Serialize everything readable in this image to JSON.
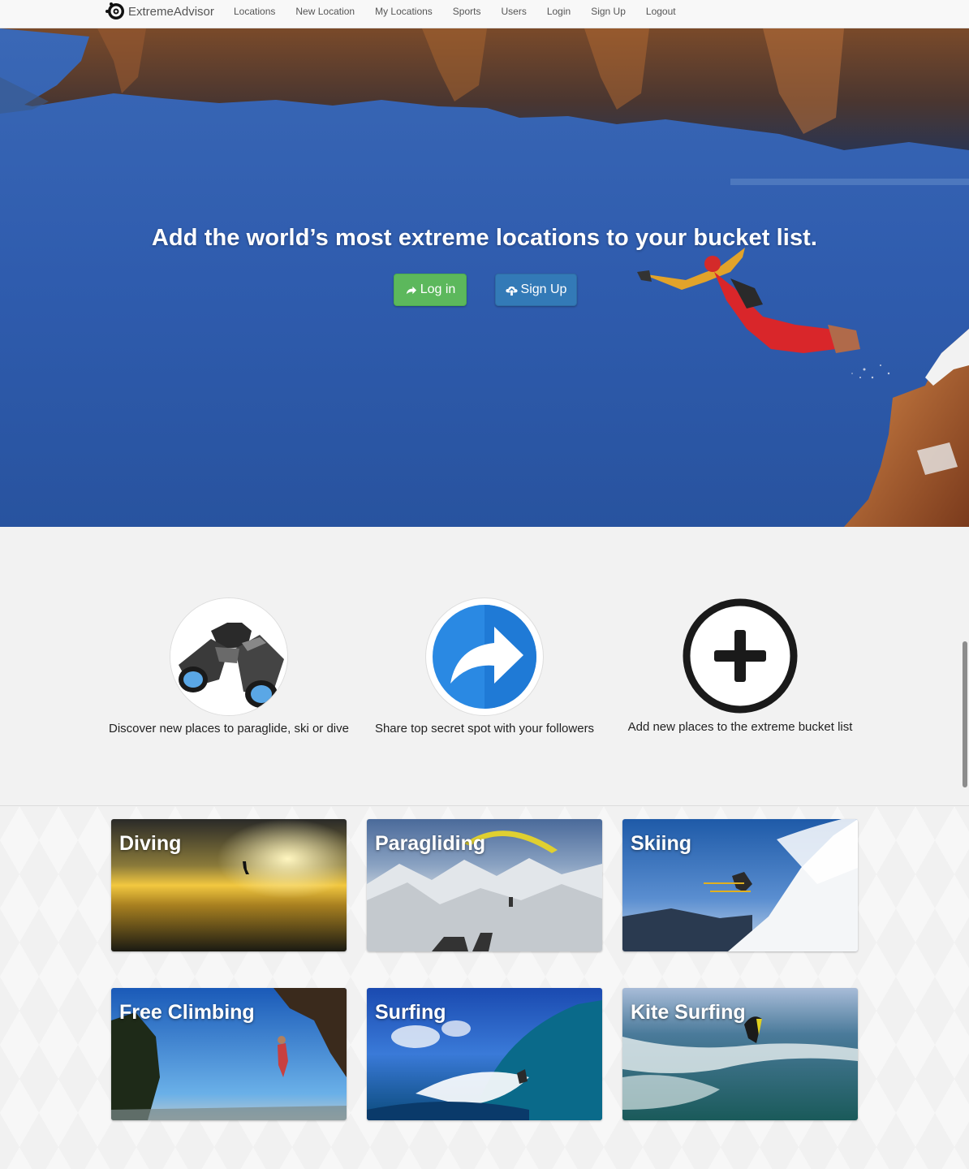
{
  "nav": {
    "brand": "ExtremeAdvisor",
    "links": [
      "Locations",
      "New Location",
      "My Locations",
      "Sports",
      "Users",
      "Login",
      "Sign Up",
      "Logout"
    ]
  },
  "hero": {
    "headline": "Add the world’s most extreme locations to your bucket list.",
    "login_label": "Log in",
    "signup_label": "Sign Up"
  },
  "features": [
    {
      "icon": "binoculars-icon",
      "text": "Discover new places to paraglide, ski or dive"
    },
    {
      "icon": "share-arrow-icon",
      "text": "Share top secret spot with your followers"
    },
    {
      "icon": "plus-circle-icon",
      "text": "Add new places to the extreme bucket list"
    }
  ],
  "sports": [
    "Diving",
    "Paragliding",
    "Skiing",
    "Free Climbing",
    "Surfing",
    "Kite Surfing"
  ],
  "colors": {
    "login_button": "#5cb85c",
    "signup_button": "#337ab7",
    "hero_water": "#2f5cae",
    "share_icon": "#2a89e3"
  }
}
